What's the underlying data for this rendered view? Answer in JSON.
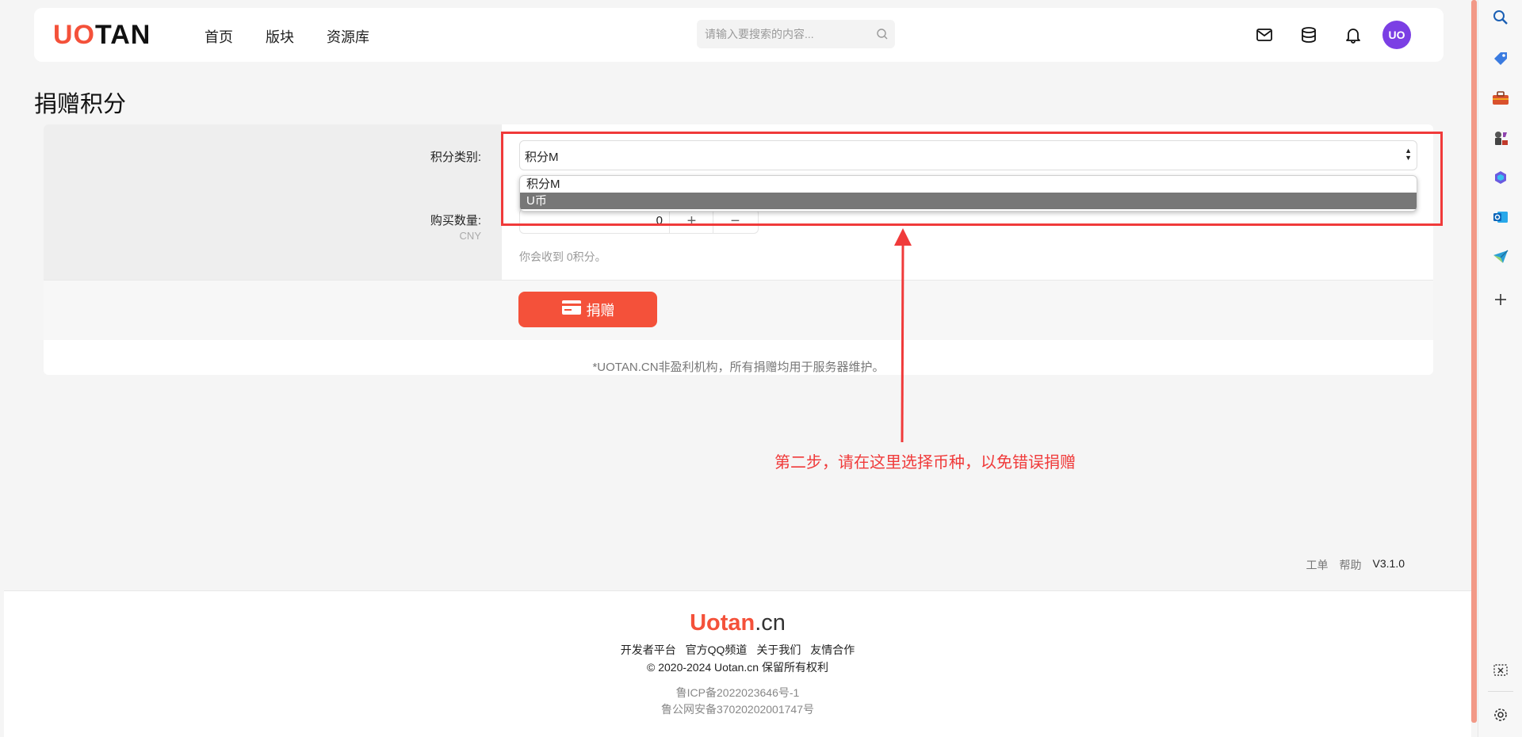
{
  "header": {
    "logo_uo": "UO",
    "logo_tan": "TAN",
    "nav": [
      "首页",
      "版块",
      "资源库"
    ],
    "search_placeholder": "请输入要搜索的内容...",
    "avatar_text": "UO"
  },
  "page_title": "捐赠积分",
  "form": {
    "category_label": "积分类别:",
    "category_value": "积分M",
    "options": [
      "积分M",
      "U币"
    ],
    "selected_option": "U币",
    "quantity_label": "购买数量:",
    "quantity_unit": "CNY",
    "quantity_value": "0",
    "plus": "+",
    "minus": "−",
    "hint": "你会收到 0积分。",
    "donate_button": "捐赠",
    "disclaimer": "*UOTAN.CN非盈利机构，所有捐赠均用于服务器维护。"
  },
  "annotation": {
    "text": "第二步，请在这里选择币种，以免错误捐赠",
    "color": "#f03a3a"
  },
  "footer": {
    "links_right": [
      "工单",
      "帮助"
    ],
    "version": "V3.1.0",
    "logo_main": "Uotan",
    "logo_suffix": ".cn",
    "links": [
      "开发者平台",
      "官方QQ频道",
      "关于我们",
      "友情合作"
    ],
    "copyright": "© 2020-2024 Uotan.cn 保留所有权利",
    "icp": "鲁ICP备2022023646号-1",
    "police": "鲁公网安备37020202001747号"
  },
  "sidebar_icons": [
    "search-icon",
    "tag-icon",
    "toolbox-icon",
    "chess-icon",
    "copilot-icon",
    "outlook-icon",
    "send-icon",
    "add-icon",
    "screenshot-icon",
    "settings-icon"
  ],
  "colors": {
    "brand": "#f4513a",
    "avatar": "#7b3fe4"
  }
}
